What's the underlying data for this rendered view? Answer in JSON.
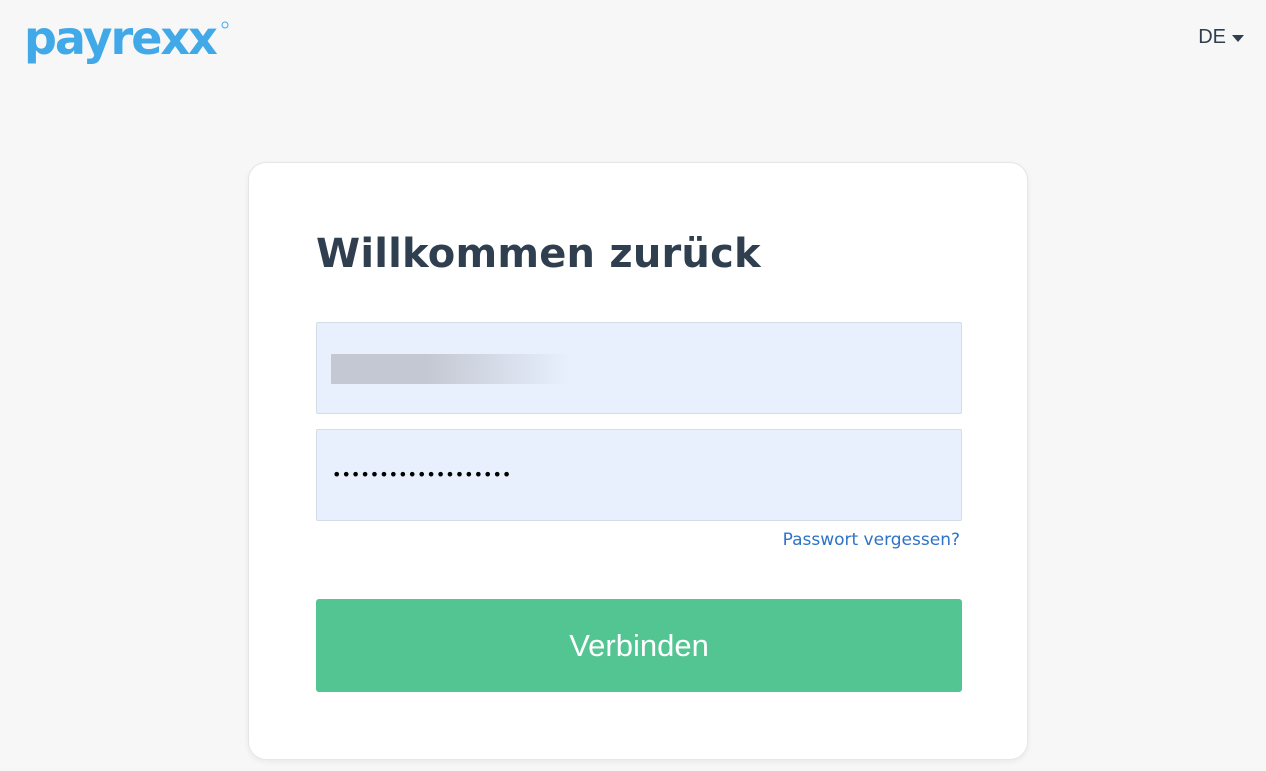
{
  "header": {
    "logo_text": "payrexx",
    "language": "DE"
  },
  "login": {
    "title": "Willkommen zurück",
    "email_value": "",
    "password_mask": "•••••••••••••••••••",
    "forgot_link": "Passwort vergessen?",
    "submit_label": "Verbinden"
  },
  "colors": {
    "brand": "#41a9e8",
    "primary_button": "#52c592",
    "link": "#2e72c8",
    "autofill": "#e8f0fe"
  },
  "icons": {
    "language_toggle": "caret-down-icon"
  }
}
